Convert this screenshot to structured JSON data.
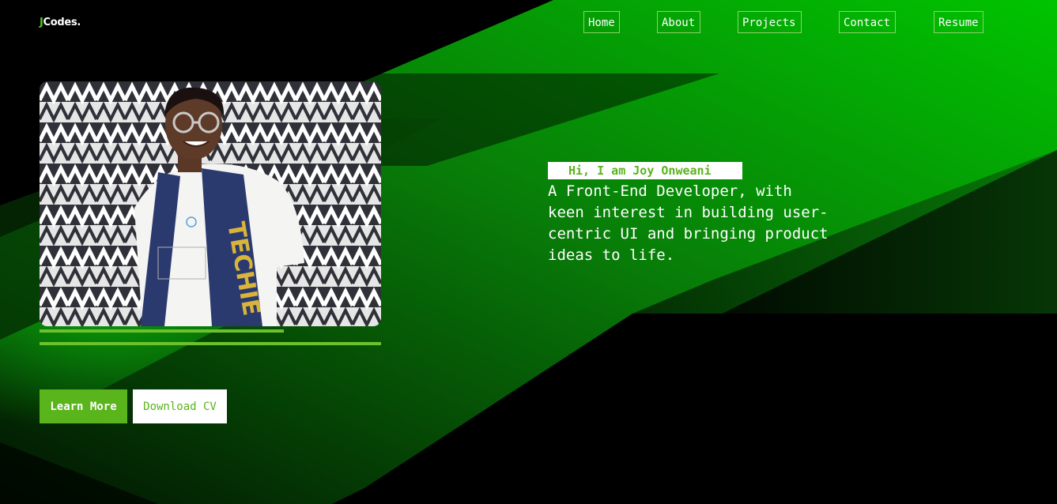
{
  "brand": {
    "logo_initial": "J",
    "logo_rest": "Codes.",
    "accent_color": "#4fc81f"
  },
  "nav": {
    "items": [
      {
        "label": "Home"
      },
      {
        "label": "About"
      },
      {
        "label": "Projects"
      },
      {
        "label": "Contact"
      },
      {
        "label": "Resume"
      }
    ]
  },
  "hero": {
    "greeting": "Hi, I am Joy Onweani",
    "tagline": "A Front-End Developer, with keen interest in building user-centric UI and bringing product ideas to life.",
    "photo_icon": "profile-photo",
    "learn_more_label": "Learn More",
    "download_cv_label": "Download CV"
  },
  "colors": {
    "primary_green": "#5ab41c",
    "background": "#000000",
    "text": "#ffffff"
  }
}
